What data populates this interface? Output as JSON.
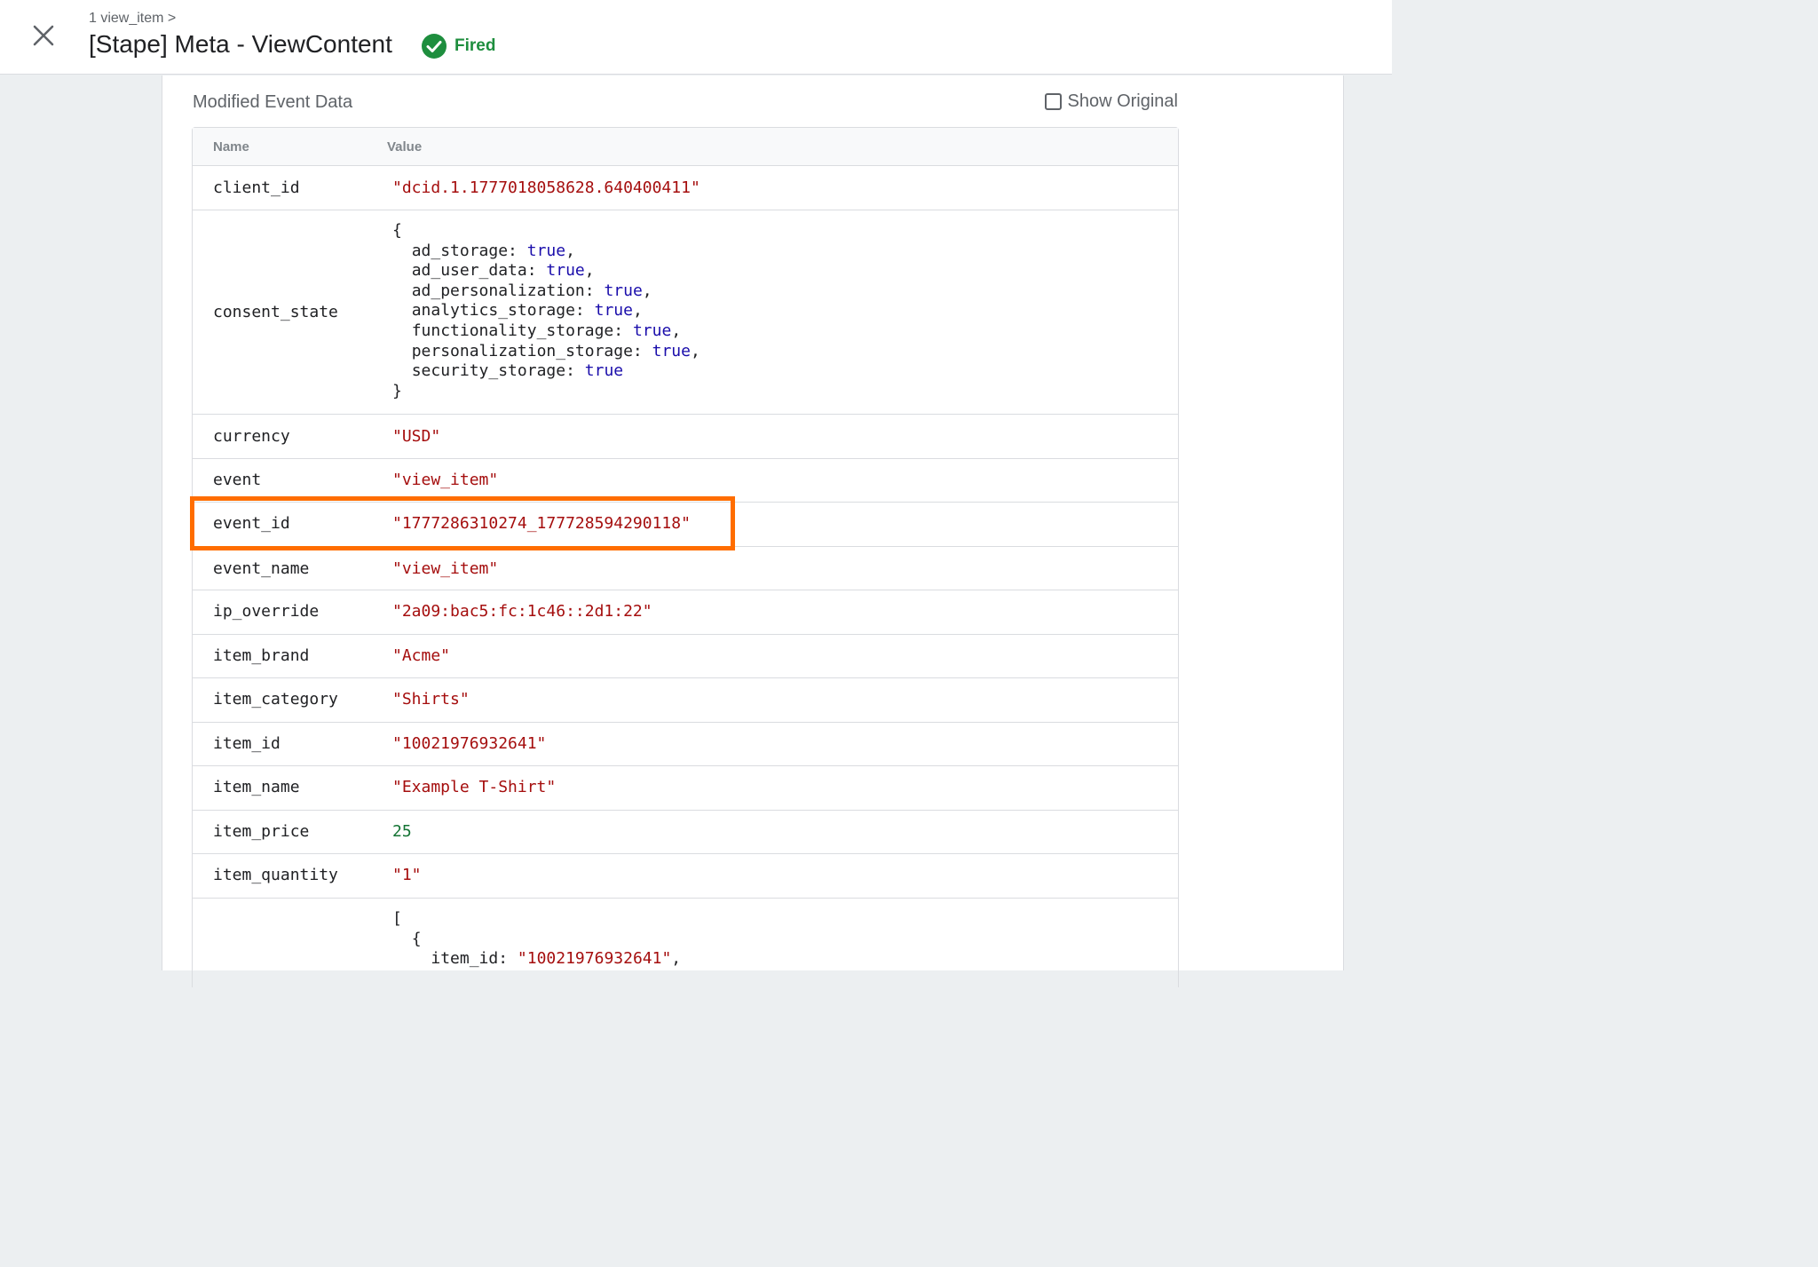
{
  "header": {
    "breadcrumb": "1 view_item >",
    "title": "[Stape] Meta - ViewContent",
    "status": "Fired"
  },
  "section": {
    "title": "Modified Event Data",
    "show_original_label": "Show Original",
    "show_original_checked": false
  },
  "table": {
    "headers": {
      "name": "Name",
      "value": "Value"
    },
    "rows": {
      "client_id": {
        "name": "client_id",
        "value": "\"dcid.1.1777018058628.640400411\""
      },
      "consent_state": {
        "name": "consent_state",
        "open": "{",
        "close": "}",
        "entries": [
          {
            "key": "ad_storage:",
            "value": "true",
            "sep": ","
          },
          {
            "key": "ad_user_data:",
            "value": "true",
            "sep": ","
          },
          {
            "key": "ad_personalization:",
            "value": "true",
            "sep": ","
          },
          {
            "key": "analytics_storage:",
            "value": "true",
            "sep": ","
          },
          {
            "key": "functionality_storage:",
            "value": "true",
            "sep": ","
          },
          {
            "key": "personalization_storage:",
            "value": "true",
            "sep": ","
          },
          {
            "key": "security_storage:",
            "value": "true",
            "sep": ""
          }
        ]
      },
      "currency": {
        "name": "currency",
        "value": "\"USD\""
      },
      "event": {
        "name": "event",
        "value": "\"view_item\""
      },
      "event_id": {
        "name": "event_id",
        "value": "\"1777286310274_177728594290118\""
      },
      "event_name": {
        "name": "event_name",
        "value": "\"view_item\""
      },
      "ip_override": {
        "name": "ip_override",
        "value": "\"2a09:bac5:fc:1c46::2d1:22\""
      },
      "item_brand": {
        "name": "item_brand",
        "value": "\"Acme\""
      },
      "item_category": {
        "name": "item_category",
        "value": "\"Shirts\""
      },
      "item_id": {
        "name": "item_id",
        "value": "\"10021976932641\""
      },
      "item_name": {
        "name": "item_name",
        "value": "\"Example T-Shirt\""
      },
      "item_price": {
        "name": "item_price",
        "value": "25"
      },
      "item_quantity": {
        "name": "item_quantity",
        "value": "\"1\""
      },
      "items": {
        "open": "[",
        "inner_open": "{",
        "first_key": "item_id:",
        "first_value": "\"10021976932641\"",
        "first_sep": ","
      }
    }
  },
  "colors": {
    "string": "#a50e0e",
    "number": "#137333",
    "keyword": "#1a0dab",
    "fired": "#1e8e3e",
    "highlight": "#ff6d00"
  },
  "icons": [
    "close-icon",
    "check-circle-icon",
    "checkbox-icon"
  ]
}
